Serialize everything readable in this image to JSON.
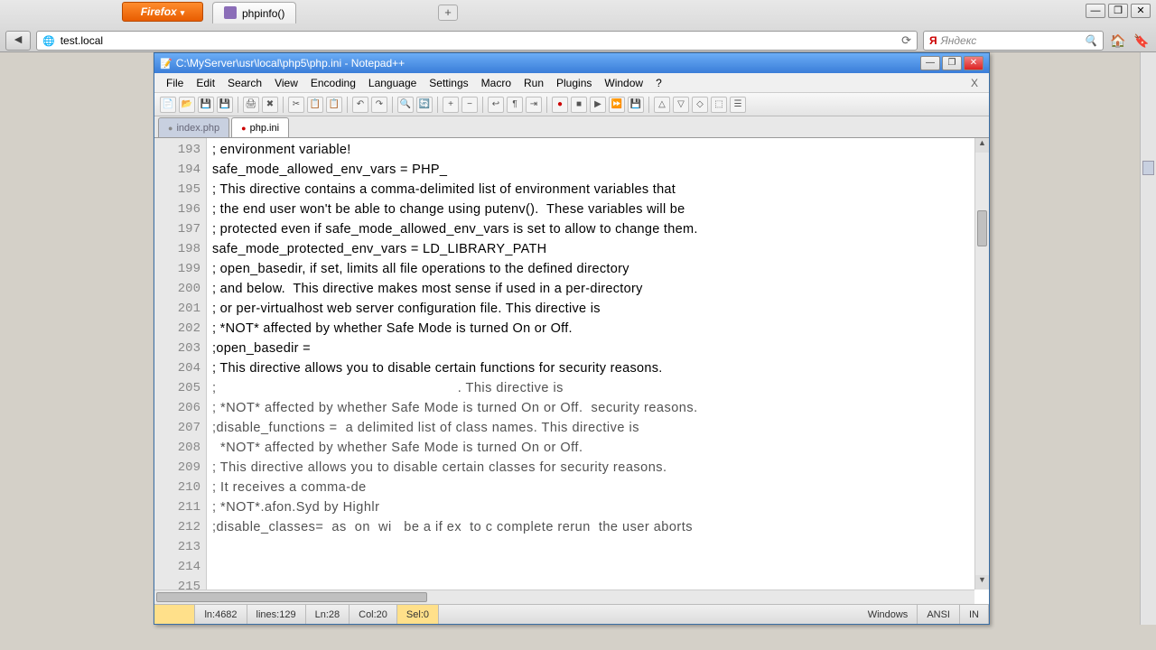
{
  "browser": {
    "ff_label": "Firefox",
    "tab_title": "phpinfo()",
    "address": "test.local",
    "search_placeholder": "Яндекс",
    "win": {
      "min": "—",
      "max": "❐",
      "close": "✕"
    },
    "newtab": "+"
  },
  "npp": {
    "title": "C:\\MyServer\\usr\\local\\php5\\php.ini - Notepad++",
    "menus": [
      "File",
      "Edit",
      "Search",
      "View",
      "Encoding",
      "Language",
      "Settings",
      "Macro",
      "Run",
      "Plugins",
      "Window",
      "?"
    ],
    "close_x": "X",
    "tabs": {
      "hidden": "index.php",
      "active": "php.ini"
    },
    "win": {
      "min": "—",
      "max": "❐",
      "close": "✕"
    },
    "lines_start": 193,
    "lines_end": 213,
    "code": [
      "; environment variable!",
      "safe_mode_allowed_env_vars = PHP_",
      "",
      "; This directive contains a comma-delimited list of environment variables that",
      "; the end user won't be able to change using putenv().  These variables will be",
      "; protected even if safe_mode_allowed_env_vars is set to allow to change them.",
      "safe_mode_protected_env_vars = LD_LIBRARY_PATH",
      "",
      "; open_basedir, if set, limits all file operations to the defined directory",
      "; and below.  This directive makes most sense if used in a per-directory",
      "; or per-virtualhost web server configuration file. This directive is",
      "; *NOT* affected by whether Safe Mode is turned On or Off.",
      ";open_basedir =",
      "",
      "; This directive allows you to disable certain functions for security reasons.",
      ";                                                           . This directive is",
      "; *NOT* affected by whether Safe Mode is turned On or Off.  security reasons.",
      ";disable_functions =  a delimited list of class names. This directive is",
      "  *NOT* affected by whether Safe Mode is turned On or Off.",
      "; This directive allows you to disable certain classes for security reasons.",
      "; It receives a comma-de",
      "; *NOT*.afon.Syd by Highlr",
      ";disable_classes=  as  on  wi   be a if ex  to c complete rerun  the user aborts"
    ],
    "status": {
      "length": "ln:4682",
      "lines": "lines:129",
      "ln": "Ln:28",
      "col": "Col:20",
      "sel": "Sel:0",
      "os": "Windows",
      "enc": "ANSI",
      "ins": "IN"
    }
  }
}
